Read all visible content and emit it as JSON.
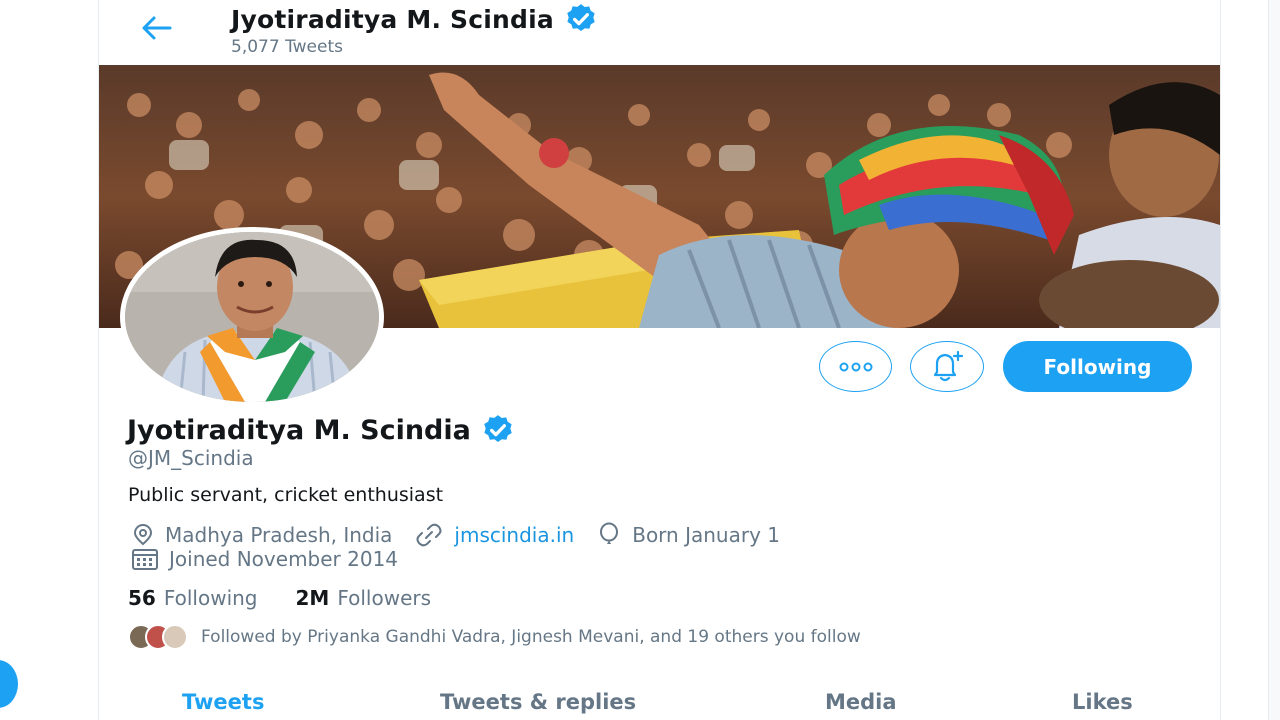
{
  "header": {
    "name": "Jyotiraditya M. Scindia",
    "tweet_count": "5,077 Tweets"
  },
  "profile": {
    "name": "Jyotiraditya M. Scindia",
    "handle": "@JM_Scindia",
    "bio": "Public servant, cricket enthusiast",
    "location": "Madhya Pradesh, India",
    "website": "jmscindia.in",
    "birthday": "Born January 1",
    "joined": "Joined November 2014",
    "following_count": "56",
    "following_label": "Following",
    "followers_count": "2M",
    "followers_label": "Followers",
    "followed_by": "Followed by Priyanka Gandhi Vadra, Jignesh Mevani, and 19 others you follow"
  },
  "actions": {
    "follow_label": "Following"
  },
  "tabs": [
    {
      "label": "Tweets",
      "active": true
    },
    {
      "label": "Tweets & replies",
      "active": false
    },
    {
      "label": "Media",
      "active": false
    },
    {
      "label": "Likes",
      "active": false
    }
  ],
  "icons": {
    "back": "arrow-left-icon",
    "verified": "verified-badge-icon",
    "more": "more-dots-icon",
    "notify": "bell-plus-icon",
    "location": "location-pin-icon",
    "link": "link-icon",
    "birthday": "balloon-icon",
    "calendar": "calendar-icon"
  },
  "colors": {
    "accent": "#1da1f2",
    "link": "#1b95e0",
    "secondary_text": "#657786",
    "primary_text": "#14171a"
  }
}
